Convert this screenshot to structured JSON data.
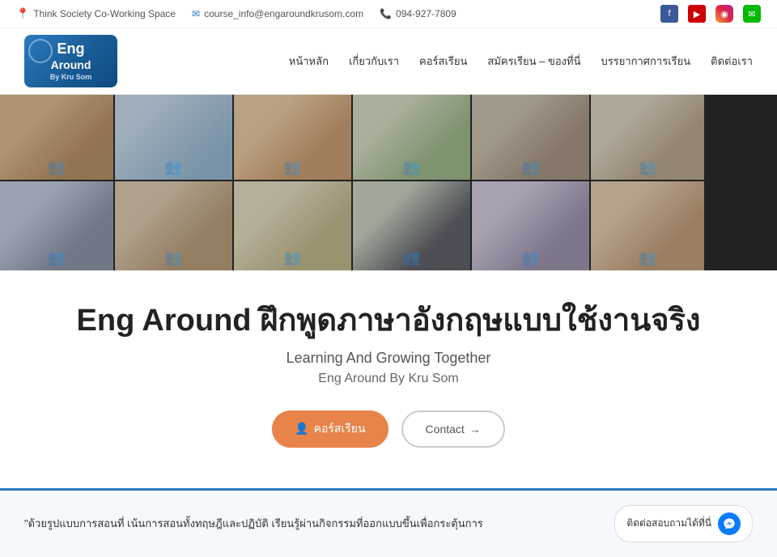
{
  "topbar": {
    "location": "Think Society Co-Working Space",
    "email": "course_info@engaroundkrusom.com",
    "phone": "094-927-7809"
  },
  "nav": {
    "logo_line1": "Eng",
    "logo_line2": "Around",
    "logo_line3": "By Kru Som",
    "links": [
      {
        "label": "หน้าหลัก",
        "id": "home"
      },
      {
        "label": "เกี่ยวกับเรา",
        "id": "about"
      },
      {
        "label": "คอร์สเรียน",
        "id": "courses"
      },
      {
        "label": "สมัครเรียน – ของที่นี่",
        "id": "register"
      },
      {
        "label": "บรรยากาศการเรียน",
        "id": "atmosphere"
      },
      {
        "label": "ติดต่อเรา",
        "id": "contact"
      }
    ]
  },
  "hero": {
    "title_prefix": "Eng Around",
    "title_thai": "ฝึกพูดภาษาอังกฤษแบบใช้งานจริง",
    "subtitle1": "Learning And Growing Together",
    "subtitle2": "Eng Around By Kru Som",
    "btn_courses": "คอร์สเรียน",
    "btn_contact": "Contact",
    "btn_arrow": "→"
  },
  "testimonial": {
    "text": "\"ด้วยรูปแบบการสอนที่ เน้นการสอนทั้งทฤษฎีและปฏิบัติ เรียนรู้ผ่านกิจกรรมที่ออกแบบขึ้นเพื่อกระตุ้นการ"
  },
  "chat": {
    "label": "ติดต่อสอบถามได้ที่นี่"
  },
  "social": {
    "icons": [
      "f",
      "▶",
      "◉",
      "✉"
    ]
  }
}
